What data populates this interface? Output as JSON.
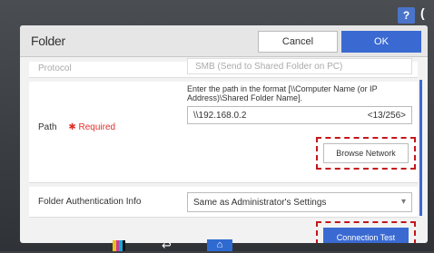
{
  "header": {
    "help_label": "?",
    "corner_glyph": "(",
    "title": "Folder",
    "cancel_label": "Cancel",
    "ok_label": "OK"
  },
  "protocol": {
    "label": "Protocol",
    "value": "SMB (Send to Shared Folder on PC)"
  },
  "path": {
    "hint": "Enter the path in the format [\\\\Computer Name (or IP Address)\\Shared Folder Name].",
    "label": "Path",
    "required_label": "✱ Required",
    "value": "\\\\192.168.0.2",
    "counter": "<13/256>",
    "browse_label": "Browse Network"
  },
  "auth": {
    "label": "Folder Authentication Info",
    "value": "Same as Administrator's Settings",
    "arrow": "▾"
  },
  "connection_test_label": "Connection Test",
  "taskbar": {
    "back_glyph": "↩",
    "home_glyph": "⌂"
  },
  "colors": {
    "accent": "#3a6ad1",
    "required": "#e0312c",
    "highlight": "#c4161c"
  }
}
